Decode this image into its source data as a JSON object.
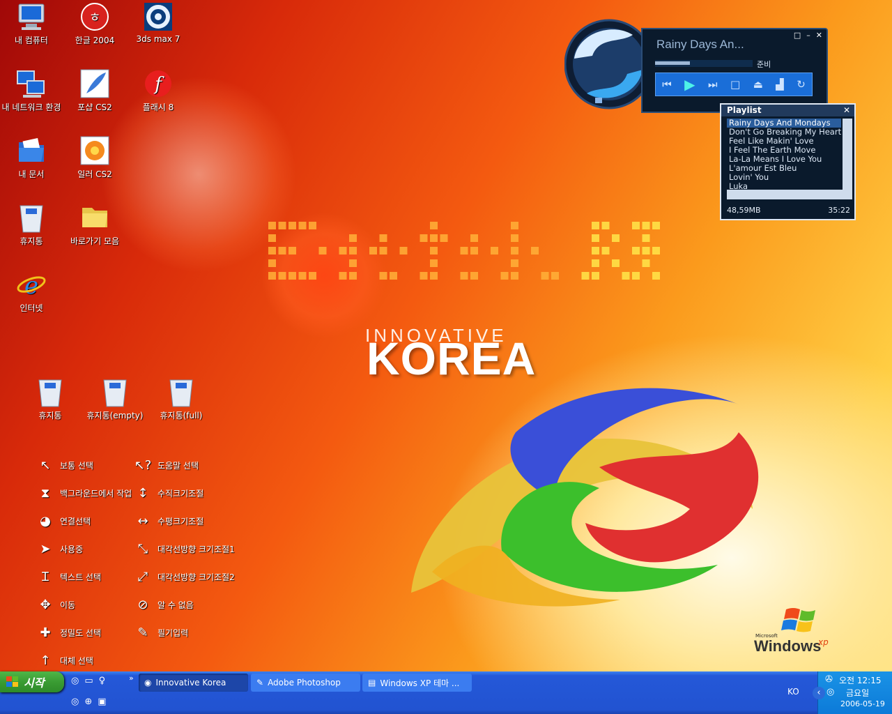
{
  "desktop_icons": [
    {
      "label": "내 컴퓨터",
      "icon": "my-computer-icon"
    },
    {
      "label": "한글 2004",
      "icon": "hangul-2004-icon"
    },
    {
      "label": "3ds max 7",
      "icon": "3ds-max-icon"
    },
    {
      "label": "내 네트워크 환경",
      "icon": "network-places-icon"
    },
    {
      "label": "포샵 CS2",
      "icon": "photoshop-feather-icon"
    },
    {
      "label": "플래시 8",
      "icon": "flash-icon"
    },
    {
      "label": "내 문서",
      "icon": "my-documents-icon"
    },
    {
      "label": "일러 CS2",
      "icon": "illustrator-flower-icon"
    },
    {
      "label": "휴지통",
      "icon": "recycle-bin-icon"
    },
    {
      "label": "바로가기 모음",
      "icon": "folder-icon"
    },
    {
      "label": "인터넷",
      "icon": "internet-explorer-icon"
    }
  ],
  "bins": [
    {
      "label": "휴지통"
    },
    {
      "label": "휴지통(empty)"
    },
    {
      "label": "휴지통(full)"
    }
  ],
  "cursors_left": [
    "보통 선택",
    "백그라운드에서 작업",
    "연결선택",
    "사용중",
    "텍스트 선택",
    "이동",
    "정밀도 선택",
    "대체 선택"
  ],
  "cursors_right": [
    "도움말 선택",
    "수직크기조절",
    "수평크기조절",
    "대각선방향 크기조절1",
    "대각선방향 크기조절2",
    "알 수 없음",
    "필기입력"
  ],
  "wallpaper": {
    "line1": "INNOVATIVE",
    "line2": "KOREA",
    "brand_small": "Microsoft",
    "brand": "Windows",
    "brand_suffix": "xp"
  },
  "player": {
    "title": "Rainy Days An...",
    "status": "준비"
  },
  "playlist": {
    "title": "Playlist",
    "items": [
      "Rainy Days And Mondays",
      "Don't Go Breaking My Heart",
      "Feel Like Makin' Love",
      "I Feel The Earth Move",
      "La-La Means I Love You",
      "L'amour Est Bleu",
      "Lovin' You",
      "Luka"
    ],
    "size": "48,59MB",
    "duration": "35:22"
  },
  "taskbar": {
    "start": "시작",
    "items": [
      "Innovative Korea",
      "Adobe Photoshop",
      "Windows XP 테마 ..."
    ],
    "lang": "KO",
    "time": "오전 12:15",
    "day": "금요일",
    "date": "2006-05-19",
    "expand": "»"
  }
}
